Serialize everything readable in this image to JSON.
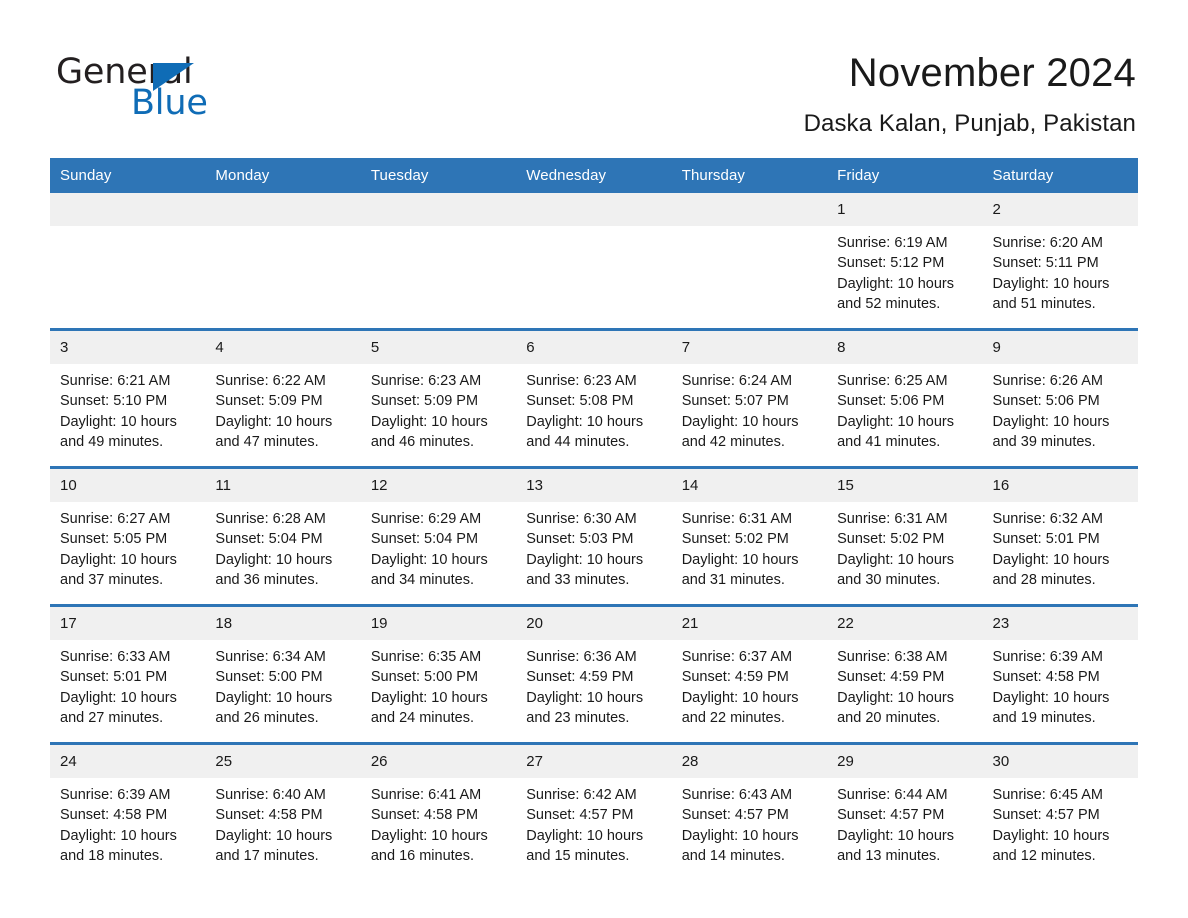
{
  "brand": {
    "name_part1": "General",
    "name_part2": "Blue",
    "triangle_color": "#0f6cb6",
    "text_color": "#231f20"
  },
  "header": {
    "title": "November 2024",
    "location": "Daska Kalan, Punjab, Pakistan"
  },
  "theme": {
    "header_blue": "#2e75b6",
    "daynum_background": "#f0f0f0",
    "text": "#1a1a1a",
    "page_background": "#ffffff"
  },
  "weekday_headers": [
    "Sunday",
    "Monday",
    "Tuesday",
    "Wednesday",
    "Thursday",
    "Friday",
    "Saturday"
  ],
  "weeks": [
    [
      {
        "day": "",
        "sunrise": "",
        "sunset": "",
        "daylight_1": "",
        "daylight_2": ""
      },
      {
        "day": "",
        "sunrise": "",
        "sunset": "",
        "daylight_1": "",
        "daylight_2": ""
      },
      {
        "day": "",
        "sunrise": "",
        "sunset": "",
        "daylight_1": "",
        "daylight_2": ""
      },
      {
        "day": "",
        "sunrise": "",
        "sunset": "",
        "daylight_1": "",
        "daylight_2": ""
      },
      {
        "day": "",
        "sunrise": "",
        "sunset": "",
        "daylight_1": "",
        "daylight_2": ""
      },
      {
        "day": "1",
        "sunrise": "Sunrise: 6:19 AM",
        "sunset": "Sunset: 5:12 PM",
        "daylight_1": "Daylight: 10 hours",
        "daylight_2": "and 52 minutes."
      },
      {
        "day": "2",
        "sunrise": "Sunrise: 6:20 AM",
        "sunset": "Sunset: 5:11 PM",
        "daylight_1": "Daylight: 10 hours",
        "daylight_2": "and 51 minutes."
      }
    ],
    [
      {
        "day": "3",
        "sunrise": "Sunrise: 6:21 AM",
        "sunset": "Sunset: 5:10 PM",
        "daylight_1": "Daylight: 10 hours",
        "daylight_2": "and 49 minutes."
      },
      {
        "day": "4",
        "sunrise": "Sunrise: 6:22 AM",
        "sunset": "Sunset: 5:09 PM",
        "daylight_1": "Daylight: 10 hours",
        "daylight_2": "and 47 minutes."
      },
      {
        "day": "5",
        "sunrise": "Sunrise: 6:23 AM",
        "sunset": "Sunset: 5:09 PM",
        "daylight_1": "Daylight: 10 hours",
        "daylight_2": "and 46 minutes."
      },
      {
        "day": "6",
        "sunrise": "Sunrise: 6:23 AM",
        "sunset": "Sunset: 5:08 PM",
        "daylight_1": "Daylight: 10 hours",
        "daylight_2": "and 44 minutes."
      },
      {
        "day": "7",
        "sunrise": "Sunrise: 6:24 AM",
        "sunset": "Sunset: 5:07 PM",
        "daylight_1": "Daylight: 10 hours",
        "daylight_2": "and 42 minutes."
      },
      {
        "day": "8",
        "sunrise": "Sunrise: 6:25 AM",
        "sunset": "Sunset: 5:06 PM",
        "daylight_1": "Daylight: 10 hours",
        "daylight_2": "and 41 minutes."
      },
      {
        "day": "9",
        "sunrise": "Sunrise: 6:26 AM",
        "sunset": "Sunset: 5:06 PM",
        "daylight_1": "Daylight: 10 hours",
        "daylight_2": "and 39 minutes."
      }
    ],
    [
      {
        "day": "10",
        "sunrise": "Sunrise: 6:27 AM",
        "sunset": "Sunset: 5:05 PM",
        "daylight_1": "Daylight: 10 hours",
        "daylight_2": "and 37 minutes."
      },
      {
        "day": "11",
        "sunrise": "Sunrise: 6:28 AM",
        "sunset": "Sunset: 5:04 PM",
        "daylight_1": "Daylight: 10 hours",
        "daylight_2": "and 36 minutes."
      },
      {
        "day": "12",
        "sunrise": "Sunrise: 6:29 AM",
        "sunset": "Sunset: 5:04 PM",
        "daylight_1": "Daylight: 10 hours",
        "daylight_2": "and 34 minutes."
      },
      {
        "day": "13",
        "sunrise": "Sunrise: 6:30 AM",
        "sunset": "Sunset: 5:03 PM",
        "daylight_1": "Daylight: 10 hours",
        "daylight_2": "and 33 minutes."
      },
      {
        "day": "14",
        "sunrise": "Sunrise: 6:31 AM",
        "sunset": "Sunset: 5:02 PM",
        "daylight_1": "Daylight: 10 hours",
        "daylight_2": "and 31 minutes."
      },
      {
        "day": "15",
        "sunrise": "Sunrise: 6:31 AM",
        "sunset": "Sunset: 5:02 PM",
        "daylight_1": "Daylight: 10 hours",
        "daylight_2": "and 30 minutes."
      },
      {
        "day": "16",
        "sunrise": "Sunrise: 6:32 AM",
        "sunset": "Sunset: 5:01 PM",
        "daylight_1": "Daylight: 10 hours",
        "daylight_2": "and 28 minutes."
      }
    ],
    [
      {
        "day": "17",
        "sunrise": "Sunrise: 6:33 AM",
        "sunset": "Sunset: 5:01 PM",
        "daylight_1": "Daylight: 10 hours",
        "daylight_2": "and 27 minutes."
      },
      {
        "day": "18",
        "sunrise": "Sunrise: 6:34 AM",
        "sunset": "Sunset: 5:00 PM",
        "daylight_1": "Daylight: 10 hours",
        "daylight_2": "and 26 minutes."
      },
      {
        "day": "19",
        "sunrise": "Sunrise: 6:35 AM",
        "sunset": "Sunset: 5:00 PM",
        "daylight_1": "Daylight: 10 hours",
        "daylight_2": "and 24 minutes."
      },
      {
        "day": "20",
        "sunrise": "Sunrise: 6:36 AM",
        "sunset": "Sunset: 4:59 PM",
        "daylight_1": "Daylight: 10 hours",
        "daylight_2": "and 23 minutes."
      },
      {
        "day": "21",
        "sunrise": "Sunrise: 6:37 AM",
        "sunset": "Sunset: 4:59 PM",
        "daylight_1": "Daylight: 10 hours",
        "daylight_2": "and 22 minutes."
      },
      {
        "day": "22",
        "sunrise": "Sunrise: 6:38 AM",
        "sunset": "Sunset: 4:59 PM",
        "daylight_1": "Daylight: 10 hours",
        "daylight_2": "and 20 minutes."
      },
      {
        "day": "23",
        "sunrise": "Sunrise: 6:39 AM",
        "sunset": "Sunset: 4:58 PM",
        "daylight_1": "Daylight: 10 hours",
        "daylight_2": "and 19 minutes."
      }
    ],
    [
      {
        "day": "24",
        "sunrise": "Sunrise: 6:39 AM",
        "sunset": "Sunset: 4:58 PM",
        "daylight_1": "Daylight: 10 hours",
        "daylight_2": "and 18 minutes."
      },
      {
        "day": "25",
        "sunrise": "Sunrise: 6:40 AM",
        "sunset": "Sunset: 4:58 PM",
        "daylight_1": "Daylight: 10 hours",
        "daylight_2": "and 17 minutes."
      },
      {
        "day": "26",
        "sunrise": "Sunrise: 6:41 AM",
        "sunset": "Sunset: 4:58 PM",
        "daylight_1": "Daylight: 10 hours",
        "daylight_2": "and 16 minutes."
      },
      {
        "day": "27",
        "sunrise": "Sunrise: 6:42 AM",
        "sunset": "Sunset: 4:57 PM",
        "daylight_1": "Daylight: 10 hours",
        "daylight_2": "and 15 minutes."
      },
      {
        "day": "28",
        "sunrise": "Sunrise: 6:43 AM",
        "sunset": "Sunset: 4:57 PM",
        "daylight_1": "Daylight: 10 hours",
        "daylight_2": "and 14 minutes."
      },
      {
        "day": "29",
        "sunrise": "Sunrise: 6:44 AM",
        "sunset": "Sunset: 4:57 PM",
        "daylight_1": "Daylight: 10 hours",
        "daylight_2": "and 13 minutes."
      },
      {
        "day": "30",
        "sunrise": "Sunrise: 6:45 AM",
        "sunset": "Sunset: 4:57 PM",
        "daylight_1": "Daylight: 10 hours",
        "daylight_2": "and 12 minutes."
      }
    ]
  ]
}
